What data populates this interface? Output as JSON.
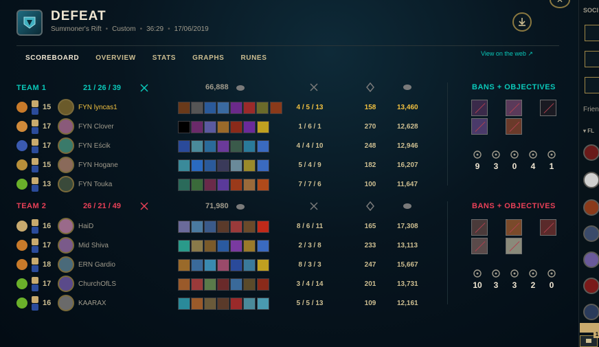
{
  "header": {
    "result": "DEFEAT",
    "map": "Summoner's Rift",
    "mode": "Custom",
    "duration": "36:29",
    "date": "17/06/2019"
  },
  "tabs": [
    {
      "label": "SCOREBOARD"
    },
    {
      "label": "OVERVIEW"
    },
    {
      "label": "STATS"
    },
    {
      "label": "GRAPHS"
    },
    {
      "label": "RUNES"
    }
  ],
  "view_on_web": "View on the web",
  "team1": {
    "name": "TEAM 1",
    "kda": "21 / 26 / 39",
    "gold_total": "66,888",
    "players": [
      {
        "level": "15",
        "name": "FYN lyncas1",
        "kda": "4 / 5 / 13",
        "cs": "158",
        "gold": "13,460",
        "self": true,
        "champ_color": "#6a5a2a"
      },
      {
        "level": "17",
        "name": "FYN Clover",
        "kda": "1 / 6 / 1",
        "cs": "270",
        "gold": "12,628",
        "self": false,
        "champ_color": "#8a5a7a"
      },
      {
        "level": "17",
        "name": "FYN Eścik",
        "kda": "4 / 4 / 10",
        "cs": "248",
        "gold": "12,946",
        "self": false,
        "champ_color": "#3a7a6a"
      },
      {
        "level": "15",
        "name": "FYN Hogane",
        "kda": "5 / 4 / 9",
        "cs": "182",
        "gold": "16,207",
        "self": false,
        "champ_color": "#8a6a5a"
      },
      {
        "level": "13",
        "name": "FYN Touka",
        "kda": "7 / 7 / 6",
        "cs": "100",
        "gold": "11,647",
        "self": false,
        "champ_color": "#3a4a3a"
      }
    ]
  },
  "team2": {
    "name": "TEAM 2",
    "kda": "26 / 21 / 49",
    "gold_total": "71,980",
    "players": [
      {
        "level": "16",
        "name": "HaiD",
        "kda": "8 / 6 / 11",
        "cs": "165",
        "gold": "17,308",
        "self": false,
        "champ_color": "#9a6a8a"
      },
      {
        "level": "17",
        "name": "Mid Shiva",
        "kda": "2 / 3 / 8",
        "cs": "233",
        "gold": "13,113",
        "self": false,
        "champ_color": "#7a5a8a"
      },
      {
        "level": "18",
        "name": "ERN Gardio",
        "kda": "8 / 3 / 3",
        "cs": "247",
        "gold": "15,667",
        "self": false,
        "champ_color": "#4a6a7a"
      },
      {
        "level": "17",
        "name": "ChurchOfLS",
        "kda": "3 / 4 / 14",
        "cs": "201",
        "gold": "13,731",
        "self": false,
        "champ_color": "#5a4a8a"
      },
      {
        "level": "16",
        "name": "KAARAX",
        "kda": "5 / 5 / 13",
        "cs": "109",
        "gold": "12,161",
        "self": false,
        "champ_color": "#6a6a6a"
      }
    ]
  },
  "bans_title": "BANS + OBJECTIVES",
  "team1_objectives": [
    "9",
    "3",
    "0",
    "4",
    "1"
  ],
  "team2_objectives": [
    "10",
    "3",
    "3",
    "2",
    "0"
  ],
  "social": {
    "label": "SOCI",
    "friends_label": "Frien",
    "folder_label": "▾ FL",
    "chat_badge": "1"
  },
  "colors": {
    "team1": "#0ac8b9",
    "team2": "#e84057",
    "gold": "#c8aa6e",
    "self": "#f0c040"
  }
}
